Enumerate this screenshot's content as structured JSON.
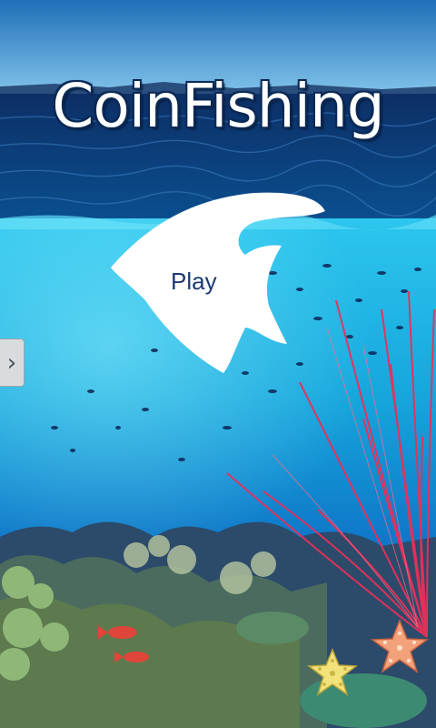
{
  "game": {
    "title": "CoinFishing",
    "play_label": "Play"
  },
  "side_tab": {
    "icon": "chevron-right-icon",
    "glyph": "›"
  },
  "colors": {
    "sky": "#2f86c9",
    "ocean_surface": "#0b3f7a",
    "water": "#1aa9d8",
    "deep": "#0b3a8c",
    "coral_red": "#e8305a",
    "title_outline": "#0b2a55",
    "play_text": "#1c3a6e"
  }
}
